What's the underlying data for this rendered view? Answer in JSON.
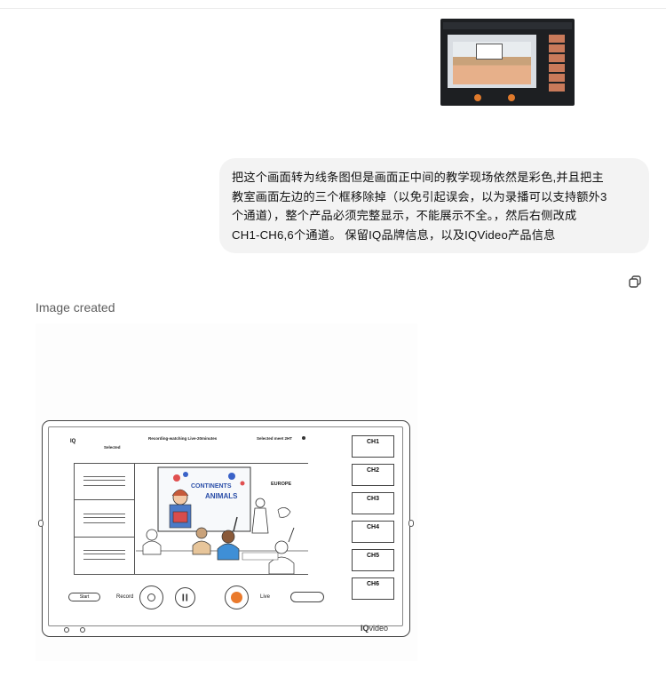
{
  "prompt": {
    "lines": [
      "把这个画面转为线条图但是画面正中间的教学现场依然是彩色,并且把主",
      "教室画面左边的三个框移除掉（以免引起误会，以为录播可以支持额外3",
      "个通道），整个产品必须完整显示，不能展示不全。，然后右侧改成",
      "CH1-CH6,6个通道。 保留IQ品牌信息，以及IQVideo产品信息"
    ]
  },
  "response": {
    "status": "Image created"
  },
  "generated_ui": {
    "logo": "IQ",
    "title": "Recording-watching Live-20minutes",
    "school": "Selected",
    "right_text": "Selected meet 2HT",
    "channels": [
      "CH1",
      "CH2",
      "CH3",
      "CH4",
      "CH5",
      "CH6"
    ],
    "start_label": "Start",
    "record_label": "Record",
    "live_label": "Live",
    "brand_bold": "IQ",
    "brand_rest": "video",
    "poster_line1": "CONTINENTS",
    "poster_line2": "ANIMALS",
    "europe_label": "EUROPE"
  },
  "colors": {
    "bubble_bg": "#f3f3f3",
    "record_orange": "#ea7a2c",
    "text": "#0d0d0d",
    "muted": "#5d5d5d"
  }
}
